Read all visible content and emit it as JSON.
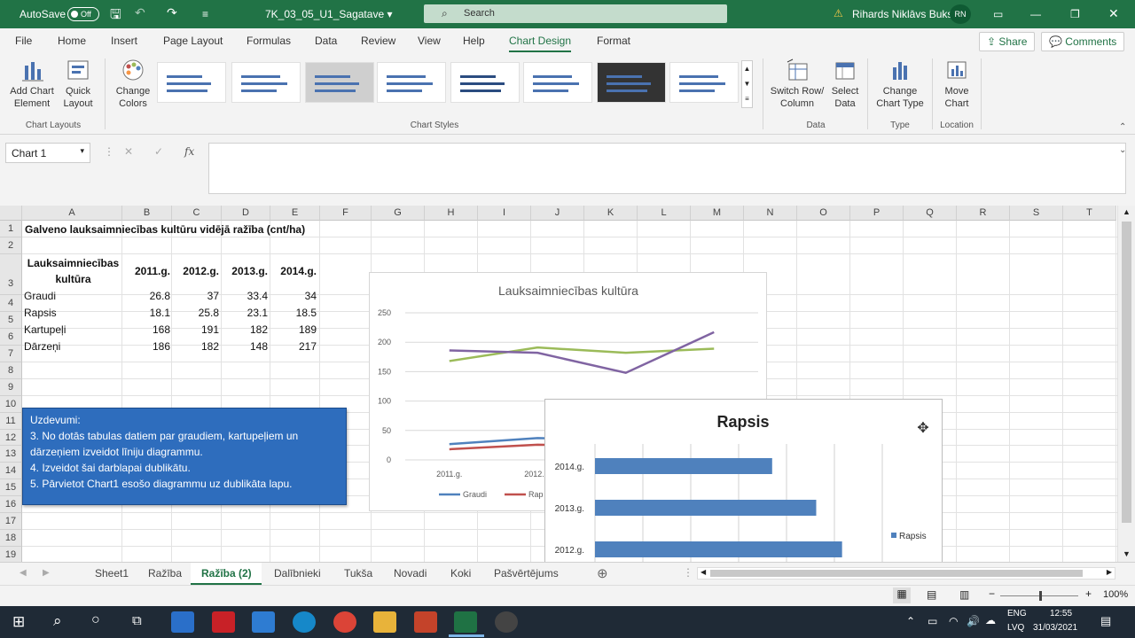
{
  "titlebar": {
    "autosave_label": "AutoSave",
    "autosave_state": "Off",
    "file_name": "7K_03_05_U1_Sagatave",
    "search_placeholder": "Search",
    "user_name": "Rihards Niklāvs Buks",
    "user_initials": "RN"
  },
  "menu": {
    "items": [
      "File",
      "Home",
      "Insert",
      "Page Layout",
      "Formulas",
      "Data",
      "Review",
      "View",
      "Help",
      "Chart Design",
      "Format"
    ],
    "active": "Chart Design",
    "share_label": "Share",
    "comments_label": "Comments"
  },
  "ribbon": {
    "add_chart_element": "Add Chart Element",
    "quick_layout": "Quick Layout",
    "change_colors": "Change Colors",
    "switch_row_column": "Switch Row/ Column",
    "select_data": "Select Data",
    "change_chart_type": "Change Chart Type",
    "move_chart": "Move Chart",
    "groups": {
      "chart_layouts": "Chart Layouts",
      "chart_styles": "Chart Styles",
      "data": "Data",
      "type": "Type",
      "location": "Location"
    }
  },
  "formula_bar": {
    "name_box": "Chart 1",
    "fx": "fx",
    "value": ""
  },
  "columns": [
    "A",
    "B",
    "C",
    "D",
    "E",
    "F",
    "G",
    "H",
    "I",
    "J",
    "K",
    "L",
    "M",
    "N",
    "O",
    "P",
    "Q",
    "R",
    "S",
    "T"
  ],
  "rows": [
    "1",
    "2",
    "3",
    "4",
    "5",
    "6",
    "7",
    "8",
    "9",
    "10",
    "11",
    "12",
    "13",
    "14",
    "15",
    "16",
    "17",
    "18",
    "19",
    "20"
  ],
  "sheet": {
    "title": "Galveno lauksaimniecības kultūru vidējā ražība (cnt/ha)",
    "header_first_line1": "Lauksaimniecības",
    "header_first_line2": "kultūra",
    "headers": [
      "2011.g.",
      "2012.g.",
      "2013.g.",
      "2014.g."
    ],
    "data_rows": [
      {
        "name": "Graudi",
        "values": [
          "26.8",
          "37",
          "33.4",
          "34"
        ]
      },
      {
        "name": "Rapsis",
        "values": [
          "18.1",
          "25.8",
          "23.1",
          "18.5"
        ]
      },
      {
        "name": "Kartupeļi",
        "values": [
          "168",
          "191",
          "182",
          "189"
        ]
      },
      {
        "name": "Dārzeņi",
        "values": [
          "186",
          "182",
          "148",
          "217"
        ]
      }
    ]
  },
  "task": {
    "heading": "Uzdevumi:",
    "lines": [
      "3. No dotās tabulas datiem par graudiem, kartupeļiem un dārzeņiem izveidot līniju diagrammu.",
      "4. Izveidot šai darblapai dublikātu.",
      "5. Pārvietot Chart1 esošo diagrammu uz dublikāta lapu."
    ]
  },
  "chart_data": [
    {
      "type": "line",
      "title": "Lauksaimniecības kultūra",
      "categories": [
        "2011.g.",
        "2012.g.",
        "2013.g.",
        "2014.g."
      ],
      "visible_category_labels": [
        "2011.g.",
        "2012.g."
      ],
      "yticks": [
        "250",
        "200",
        "150",
        "100",
        "50",
        "0"
      ],
      "ylim": [
        0,
        250
      ],
      "grid": true,
      "legend_visible": [
        "Graudi",
        "Rap"
      ],
      "series": [
        {
          "name": "Graudi",
          "color": "#4f81bd",
          "values": [
            26.8,
            37,
            33.4,
            34
          ]
        },
        {
          "name": "Rapsis",
          "color": "#c0504d",
          "values": [
            18.1,
            25.8,
            23.1,
            18.5
          ]
        },
        {
          "name": "Kartupeļi",
          "color": "#9bbb59",
          "values": [
            168,
            191,
            182,
            189
          ]
        },
        {
          "name": "Dārzeņi",
          "color": "#8064a2",
          "values": [
            186,
            182,
            148,
            217
          ]
        }
      ]
    },
    {
      "type": "bar",
      "title": "Rapsis",
      "categories": [
        "2014.g.",
        "2013.g.",
        "2012.g."
      ],
      "values": [
        18.5,
        23.1,
        25.8
      ],
      "color": "#4f81bd",
      "legend": "Rapsis",
      "xlim": [
        0,
        30
      ],
      "grid": true
    }
  ],
  "sheet_tabs": [
    "Sheet1",
    "Ražība",
    "Ražība (2)",
    "Dalībnieki",
    "Tukša",
    "Novadi",
    "Koki",
    "Pašvērtējums"
  ],
  "active_tab": "Ražība (2)",
  "status": {
    "zoom": "100%"
  },
  "taskbar": {
    "lang1": "ENG",
    "lang2": "LVQ",
    "time": "12:55",
    "date": "31/03/2021"
  }
}
